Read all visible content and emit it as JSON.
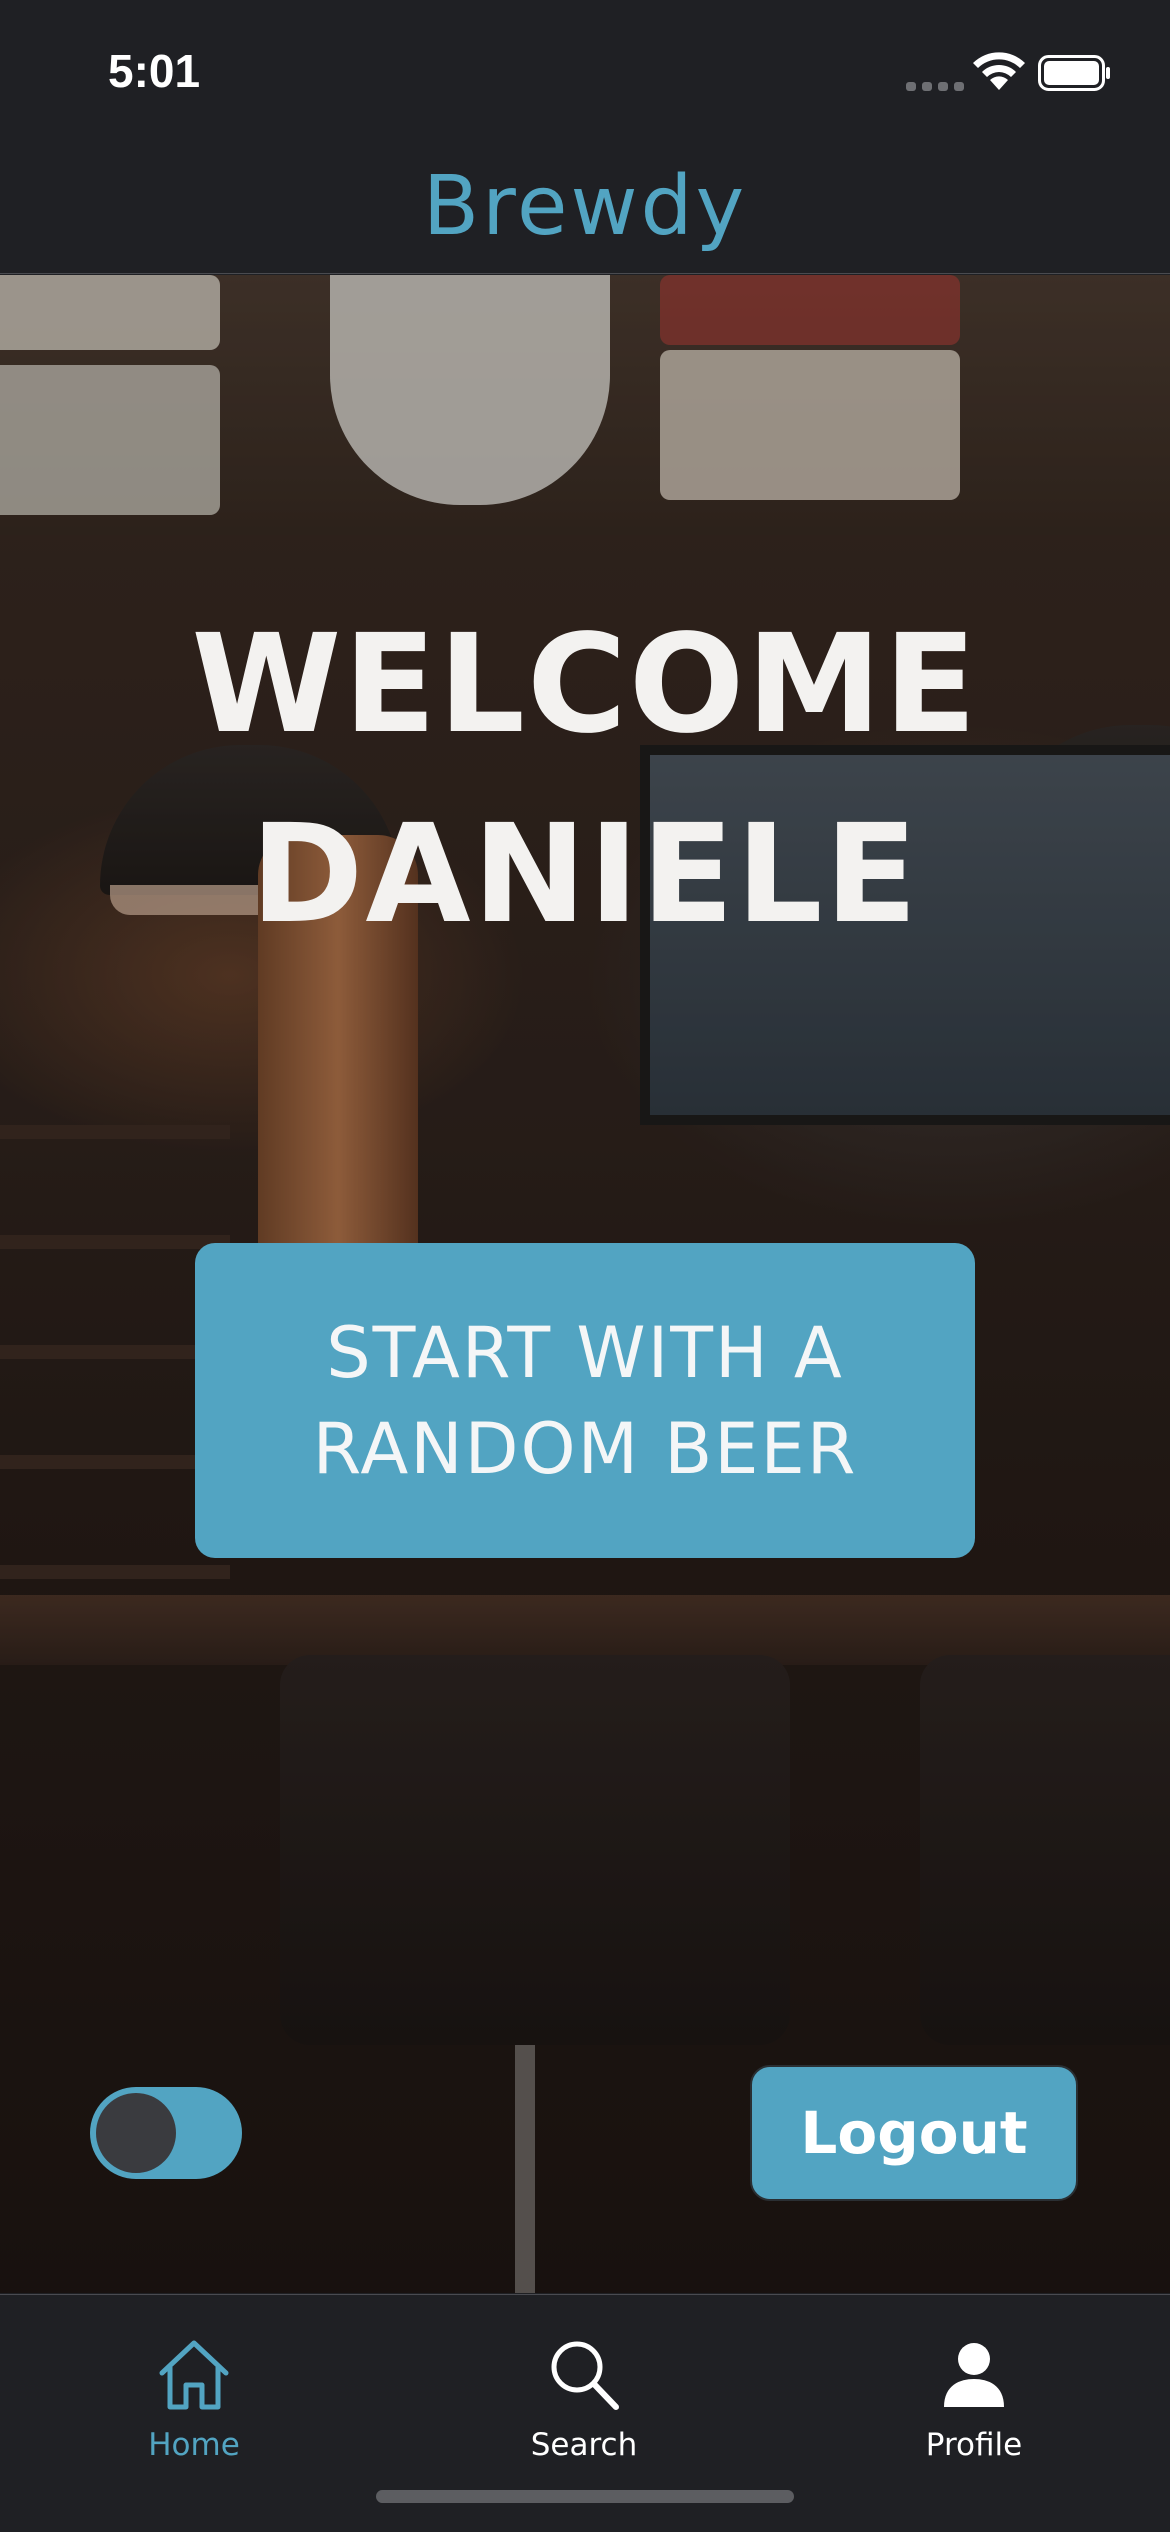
{
  "status_bar": {
    "time": "5:01"
  },
  "header": {
    "title": "Brewdy"
  },
  "hero": {
    "welcome_line1": "WELCOME",
    "welcome_line2": "DANIELE",
    "random_button_label": "START WITH A RANDOM BEER",
    "logout_label": "Logout",
    "theme_toggle_on": true
  },
  "tabs": [
    {
      "label": "Home",
      "icon": "home-icon",
      "active": true
    },
    {
      "label": "Search",
      "icon": "search-icon",
      "active": false
    },
    {
      "label": "Profile",
      "icon": "person-icon",
      "active": false
    }
  ],
  "colors": {
    "accent": "#52a4c2",
    "background": "#1f2024",
    "text": "#ffffff"
  }
}
